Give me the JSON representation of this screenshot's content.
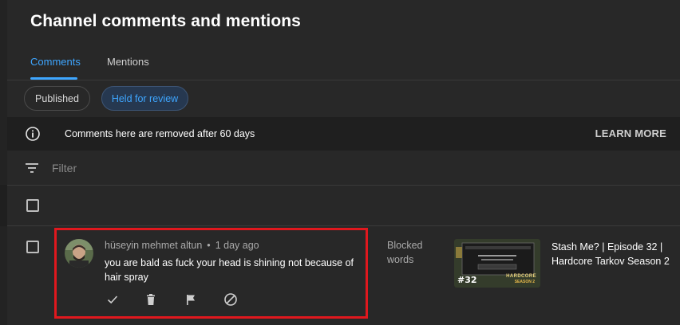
{
  "page": {
    "title": "Channel comments and mentions"
  },
  "tabs": [
    {
      "label": "Comments",
      "active": true
    },
    {
      "label": "Mentions",
      "active": false
    }
  ],
  "chips": [
    {
      "label": "Published",
      "selected": false
    },
    {
      "label": "Held for review",
      "selected": true
    }
  ],
  "notice": {
    "icon": "info-icon",
    "message": "Comments here are removed after 60 days",
    "action_label": "LEARN MORE"
  },
  "filter": {
    "icon": "filter-icon",
    "placeholder": "Filter"
  },
  "comments": [
    {
      "author": "hüseyin mehmet altun",
      "separator": "•",
      "time": "1 day ago",
      "text": "you are bald as fuck your head is shining not because of hair spray",
      "reason": "Blocked words",
      "video": {
        "title": "Stash Me? | Episode 32 | Hardcore Tarkov Season 2",
        "thumb_episode": "#32",
        "thumb_brand": "HARDCORE",
        "thumb_brand_sub": "SEASON 2"
      },
      "actions": [
        "check-icon",
        "trash-icon",
        "flag-icon",
        "block-icon"
      ]
    }
  ],
  "colors": {
    "background": "#282828",
    "accent": "#3ea6ff",
    "highlight": "#e0181e",
    "notice_bg": "#1f1f1f",
    "muted_text": "#aaaaaa"
  }
}
